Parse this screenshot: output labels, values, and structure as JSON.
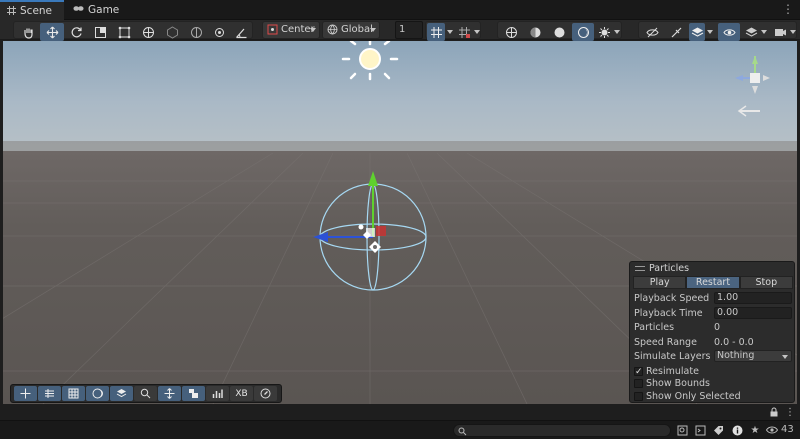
{
  "tabs": [
    {
      "label": "Scene",
      "icon": "grid-icon",
      "active": true
    },
    {
      "label": "Game",
      "icon": "gamepad-icon",
      "active": false
    }
  ],
  "toolbar": {
    "pivot_mode": "Center",
    "pivot_rotation": "Global",
    "grid_snap_value": "1"
  },
  "particles_panel": {
    "title": "Particles",
    "buttons": [
      "Play",
      "Restart",
      "Stop"
    ],
    "playback_speed_label": "Playback Speed",
    "playback_speed": "1.00",
    "playback_time_label": "Playback Time",
    "playback_time": "0.00",
    "particles_label": "Particles",
    "particles_count": "0",
    "speed_range_label": "Speed Range",
    "speed_range": "0.0 - 0.0",
    "simulate_layers_label": "Simulate Layers",
    "simulate_layers": "Nothing",
    "resimulate_label": "Resimulate",
    "resimulate_checked": true,
    "show_bounds_label": "Show Bounds",
    "show_bounds_checked": false,
    "show_only_selected_label": "Show Only Selected",
    "show_only_selected_checked": false
  },
  "overlay_toolbar": {
    "xb_label": "XB"
  },
  "statusbar": {
    "count": "43"
  },
  "colors": {
    "sky": "#a5b9c9",
    "ground": "#5f5b58",
    "accent": "#46607c",
    "x_axis": "#2c52d6",
    "y_axis": "#5fd12e",
    "z_axis": "#c83232"
  }
}
